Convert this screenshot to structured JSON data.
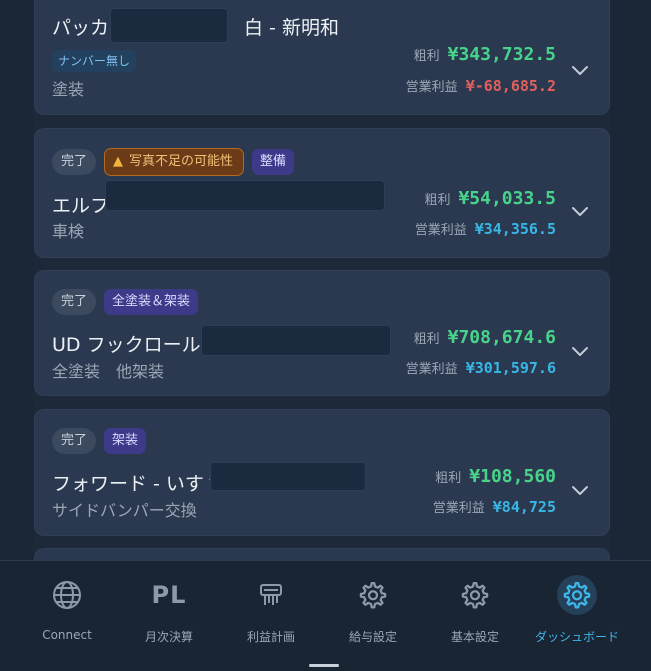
{
  "cards": [
    {
      "title": "パッカー",
      "title_suffix": "白 - 新明和",
      "tag": "ナンバー無し",
      "subtitle": "塗装",
      "gross_label": "粗利",
      "gross_value": "¥343,732.5",
      "op_label": "営業利益",
      "op_value": "¥-68,685.2"
    },
    {
      "status": "完了",
      "warning": "写真不足の可能性",
      "category": "整備",
      "title": "エルフ",
      "subtitle": "車検",
      "gross_label": "粗利",
      "gross_value": "¥54,033.5",
      "op_label": "営業利益",
      "op_value": "¥34,356.5"
    },
    {
      "status": "完了",
      "category": "全塗装＆架装",
      "title": "UD フックロール -",
      "subtitle": "全塗装　他架装",
      "gross_label": "粗利",
      "gross_value": "¥708,674.6",
      "op_label": "営業利益",
      "op_value": "¥301,597.6"
    },
    {
      "status": "完了",
      "category": "架装",
      "title": "フォワード - いすゞ",
      "subtitle": "サイドバンパー交換",
      "gross_label": "粗利",
      "gross_value": "¥108,560",
      "op_label": "営業利益",
      "op_value": "¥84,725"
    }
  ],
  "nav": [
    {
      "label": "Connect",
      "icon": "globe-icon"
    },
    {
      "label": "月次決算",
      "icon": "pl-icon",
      "icon_text": "PL"
    },
    {
      "label": "利益計画",
      "icon": "printer-icon"
    },
    {
      "label": "給与設定",
      "icon": "gear-icon"
    },
    {
      "label": "基本設定",
      "icon": "gear-icon"
    },
    {
      "label": "ダッシュボード",
      "icon": "gear-icon",
      "active": true
    }
  ],
  "colors": {
    "gross": "#49d38a",
    "op_positive": "#38b6e6",
    "op_negative": "#e0605c",
    "active_nav": "#3fb6ea"
  }
}
